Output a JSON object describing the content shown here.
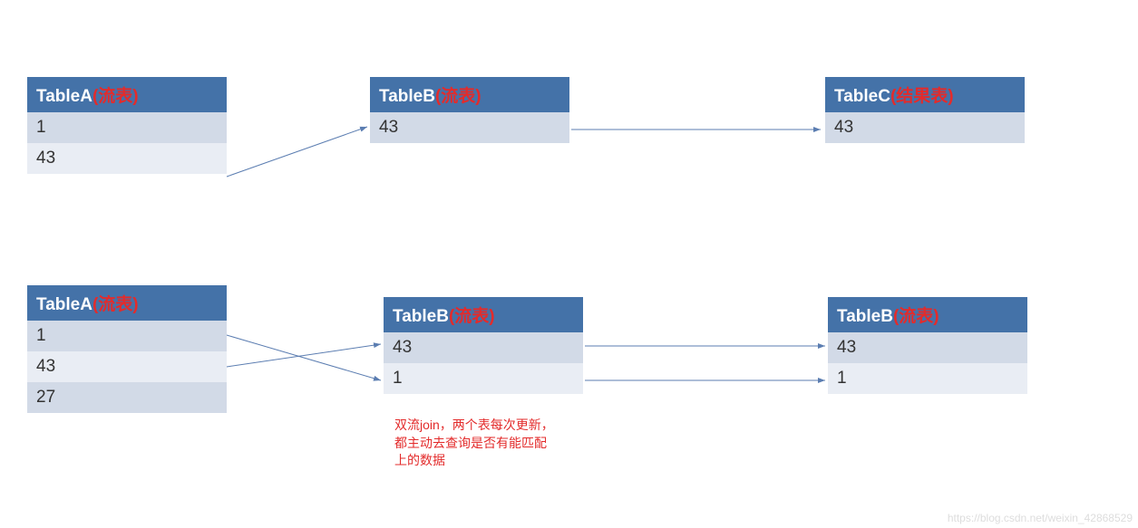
{
  "top": {
    "tableA": {
      "name": "TableA",
      "suffix": "(流表)",
      "rows": [
        "1",
        "43"
      ]
    },
    "tableB": {
      "name": "TableB",
      "suffix": "(流表)",
      "rows": [
        "43"
      ]
    },
    "tableC": {
      "name": "TableC",
      "suffix": "(结果表)",
      "rows": [
        "43"
      ]
    }
  },
  "bottom": {
    "tableA": {
      "name": "TableA",
      "suffix": "(流表)",
      "rows": [
        "1",
        "43",
        "27"
      ]
    },
    "tableB": {
      "name": "TableB",
      "suffix": "(流表)",
      "rows": [
        "43",
        "1"
      ]
    },
    "tableC": {
      "name": "TableB",
      "suffix": "(流表)",
      "rows": [
        "43",
        "1"
      ]
    }
  },
  "note": "双流join，两个表每次更新，都主动去查询是否有能匹配上的数据",
  "watermark": "https://blog.csdn.net/weixin_42868529"
}
